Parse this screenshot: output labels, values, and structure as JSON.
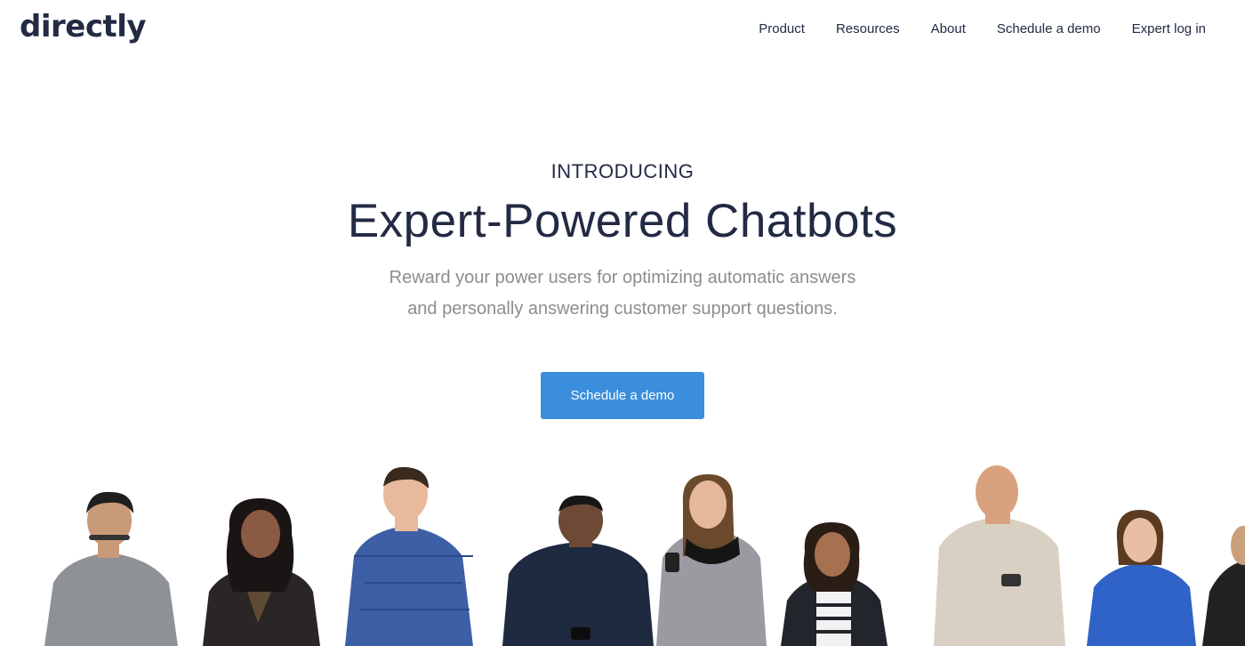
{
  "brand": {
    "logo_text": "directly"
  },
  "nav": {
    "items": [
      {
        "label": "Product"
      },
      {
        "label": "Resources"
      },
      {
        "label": "About"
      },
      {
        "label": "Schedule a demo"
      },
      {
        "label": "Expert log in"
      }
    ]
  },
  "hero": {
    "eyebrow": "INTRODUCING",
    "headline": "Expert-Powered Chatbots",
    "subtext_line1": "Reward your power users for optimizing automatic answers",
    "subtext_line2": "and personally answering customer support questions.",
    "cta_label": "Schedule a demo"
  },
  "colors": {
    "text_dark": "#232a44",
    "text_muted": "#8c8c92",
    "accent": "#3a8edb",
    "background": "#ffffff"
  },
  "people_illustration": {
    "count": 10,
    "shirt_colors": [
      "#8e9196",
      "#2a2626",
      "#3d5fa6",
      "#1e2a3f",
      "#9c9aa1",
      "#22252b",
      "#d9d0c4",
      "#2f63c7",
      "#222222"
    ],
    "skin_tones": [
      "#c99a78",
      "#8a5a43",
      "#e8b99b",
      "#6e4a36",
      "#e6b89b",
      "#a5714f",
      "#d9a27e",
      "#e9bfa3",
      "#caa07c"
    ]
  }
}
